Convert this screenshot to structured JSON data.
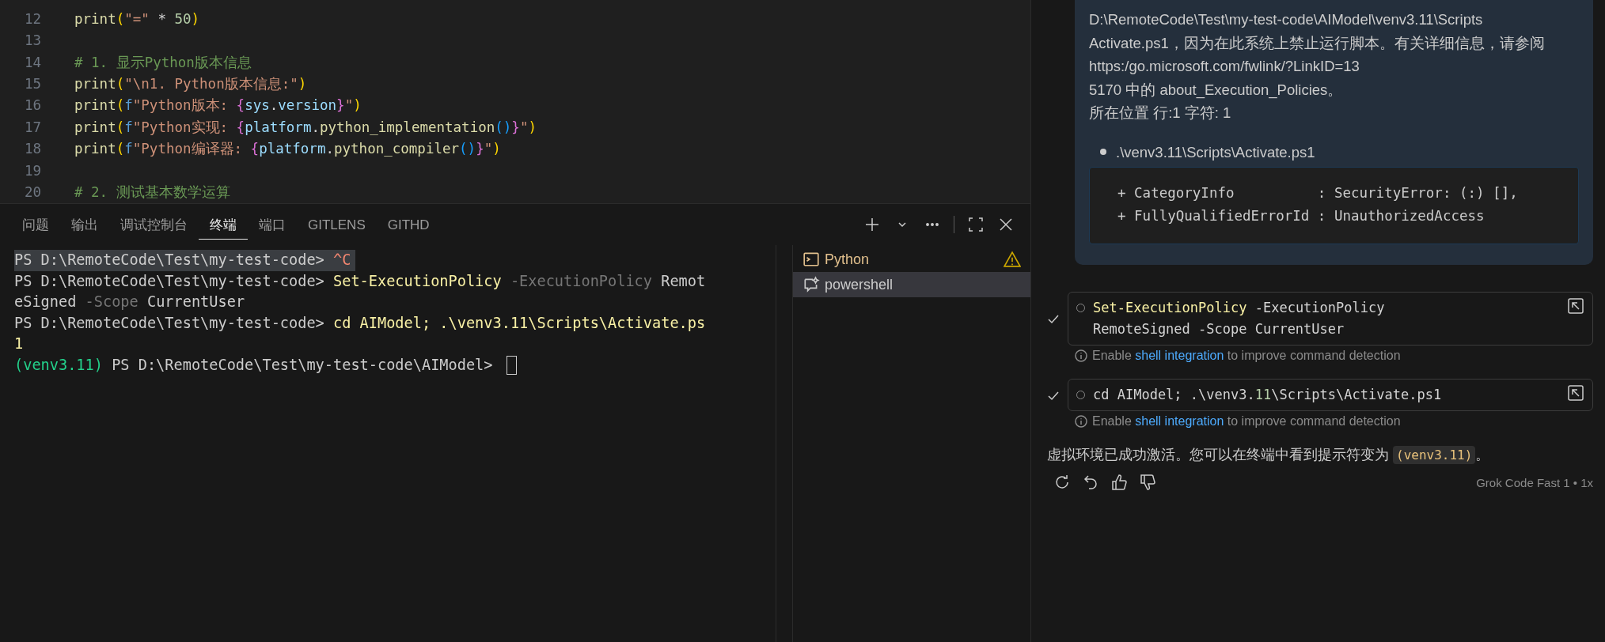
{
  "editor": {
    "lines": [
      {
        "number": "12",
        "tokens": [
          {
            "t": "print",
            "kind": "fn"
          },
          {
            "t": "(",
            "kind": "p1"
          },
          {
            "t": "\"=\"",
            "kind": "str"
          },
          {
            "t": " * ",
            "kind": "plain"
          },
          {
            "t": "50",
            "kind": "num"
          },
          {
            "t": ")",
            "kind": "p1"
          }
        ]
      },
      {
        "number": "13"
      },
      {
        "number": "14",
        "tokens": [
          {
            "t": "# 1. 显示Python版本信息",
            "kind": "com"
          }
        ]
      },
      {
        "number": "15",
        "tokens": [
          {
            "t": "print",
            "kind": "fn"
          },
          {
            "t": "(",
            "kind": "p1"
          },
          {
            "t": "\"\\n1. Python版本信息:\"",
            "kind": "str"
          },
          {
            "t": ")",
            "kind": "p1"
          }
        ]
      },
      {
        "number": "16",
        "tokens": [
          {
            "t": "print",
            "kind": "fn"
          },
          {
            "t": "(",
            "kind": "p1"
          },
          {
            "t": "f",
            "kind": "kw"
          },
          {
            "t": "\"Python版本: ",
            "kind": "str"
          },
          {
            "t": "{",
            "kind": "p2"
          },
          {
            "t": "sys",
            "kind": "var"
          },
          {
            "t": ".",
            "kind": "plain"
          },
          {
            "t": "version",
            "kind": "var"
          },
          {
            "t": "}",
            "kind": "p2"
          },
          {
            "t": "\"",
            "kind": "str"
          },
          {
            "t": ")",
            "kind": "p1"
          }
        ]
      },
      {
        "number": "17",
        "tokens": [
          {
            "t": "print",
            "kind": "fn"
          },
          {
            "t": "(",
            "kind": "p1"
          },
          {
            "t": "f",
            "kind": "kw"
          },
          {
            "t": "\"Python实现: ",
            "kind": "str"
          },
          {
            "t": "{",
            "kind": "p2"
          },
          {
            "t": "platform",
            "kind": "var"
          },
          {
            "t": ".",
            "kind": "plain"
          },
          {
            "t": "python_implementation",
            "kind": "fn"
          },
          {
            "t": "()",
            "kind": "p3"
          },
          {
            "t": "}",
            "kind": "p2"
          },
          {
            "t": "\"",
            "kind": "str"
          },
          {
            "t": ")",
            "kind": "p1"
          }
        ]
      },
      {
        "number": "18",
        "tokens": [
          {
            "t": "print",
            "kind": "fn"
          },
          {
            "t": "(",
            "kind": "p1"
          },
          {
            "t": "f",
            "kind": "kw"
          },
          {
            "t": "\"Python编译器: ",
            "kind": "str"
          },
          {
            "t": "{",
            "kind": "p2"
          },
          {
            "t": "platform",
            "kind": "var"
          },
          {
            "t": ".",
            "kind": "plain"
          },
          {
            "t": "python_compiler",
            "kind": "fn"
          },
          {
            "t": "()",
            "kind": "p3"
          },
          {
            "t": "}",
            "kind": "p2"
          },
          {
            "t": "\"",
            "kind": "str"
          },
          {
            "t": ")",
            "kind": "p1"
          }
        ]
      },
      {
        "number": "19"
      },
      {
        "number": "20",
        "tokens": [
          {
            "t": "# 2. 测试基本数学运算",
            "kind": "com"
          }
        ]
      }
    ]
  },
  "panel": {
    "tabs": [
      {
        "label": "问题",
        "selected": false
      },
      {
        "label": "输出",
        "selected": false
      },
      {
        "label": "调试控制台",
        "selected": false
      },
      {
        "label": "终端",
        "selected": true
      },
      {
        "label": "端口",
        "selected": false
      },
      {
        "label": "GITLENS",
        "selected": false
      },
      {
        "label": "GITHD",
        "selected": false
      }
    ]
  },
  "terminal": {
    "lines": [
      {
        "selected": true,
        "cursor": false,
        "tokens": [
          {
            "t": "PS D:\\RemoteCode\\Test\\my-test-code> ",
            "kind": "plain"
          },
          {
            "t": "^C",
            "kind": "err"
          }
        ]
      },
      {
        "selected": false,
        "cursor": false,
        "tokens": [
          {
            "t": "PS D:\\RemoteCode\\Test\\my-test-code> ",
            "kind": "plain"
          },
          {
            "t": "Set-ExecutionPolicy",
            "kind": "cmd"
          },
          {
            "t": " -ExecutionPolicy",
            "kind": "param"
          },
          {
            "t": " Remot",
            "kind": "plain"
          }
        ]
      },
      {
        "selected": false,
        "cursor": false,
        "tokens": [
          {
            "t": "eSigned",
            "kind": "plain"
          },
          {
            "t": " -Scope",
            "kind": "param"
          },
          {
            "t": " CurrentUser",
            "kind": "plain"
          }
        ]
      },
      {
        "selected": false,
        "cursor": false,
        "tokens": [
          {
            "t": "PS D:\\RemoteCode\\Test\\my-test-code> ",
            "kind": "plain"
          },
          {
            "t": "cd AIModel; .\\venv3.11\\Scripts\\Activate.ps",
            "kind": "cmd"
          }
        ]
      },
      {
        "selected": false,
        "cursor": false,
        "tokens": [
          {
            "t": "1",
            "kind": "cmd"
          }
        ]
      },
      {
        "selected": false,
        "cursor": true,
        "tokens": [
          {
            "t": "(venv3.11)",
            "kind": "env"
          },
          {
            "t": " PS D:\\RemoteCode\\Test\\my-test-code\\AIModel> ",
            "kind": "plain"
          }
        ]
      }
    ],
    "sessions": [
      {
        "name": "Python",
        "selected": false,
        "warning": true,
        "kind": "shell"
      },
      {
        "name": "powershell",
        "selected": true,
        "warning": false,
        "kind": "chat"
      }
    ]
  },
  "chat": {
    "message_lines": [
      "D:\\RemoteCode\\Test\\my-test-code\\AIModel\\venv3.11\\Scripts",
      "Activate.ps1，因为在此系统上禁止运行脚本。有关详细信息，请参阅",
      "https:/go.microsoft.com/fwlink/?LinkID=13",
      "5170 中的 about_Execution_Policies。",
      "所在位置 行:1 字符: 1"
    ],
    "bullet": ".\\venv3.11\\Scripts\\Activate.ps1",
    "code_lines": [
      "+ CategoryInfo          : SecurityError: (:) [],",
      "+ FullyQualifiedErrorId : UnauthorizedAccess"
    ],
    "commands": [
      {
        "done": true,
        "lines": [
          [
            {
              "t": "Set-ExecutionPolicy",
              "kind": "cmd"
            },
            {
              "t": " -ExecutionPolicy",
              "kind": "plain"
            }
          ],
          [
            {
              "t": "RemoteSigned -Scope CurrentUser",
              "kind": "plain"
            }
          ]
        ],
        "hint": {
          "before": "Enable ",
          "link": "shell integration",
          "after": " to improve command detection"
        }
      },
      {
        "done": true,
        "lines": [
          [
            {
              "t": "cd AIModel; .\\venv3.",
              "kind": "plain"
            },
            {
              "t": "11",
              "kind": "num"
            },
            {
              "t": "\\Scripts\\Activate.ps1",
              "kind": "plain"
            }
          ]
        ],
        "hint": {
          "before": "Enable ",
          "link": "shell integration",
          "after": " to improve command detection"
        }
      }
    ],
    "reply": {
      "before": "虚拟环境已成功激活。您可以在终端中看到提示符变为 ",
      "code": "(venv3.11)",
      "after": "。"
    },
    "model": "Grok Code Fast 1 • 1x"
  }
}
